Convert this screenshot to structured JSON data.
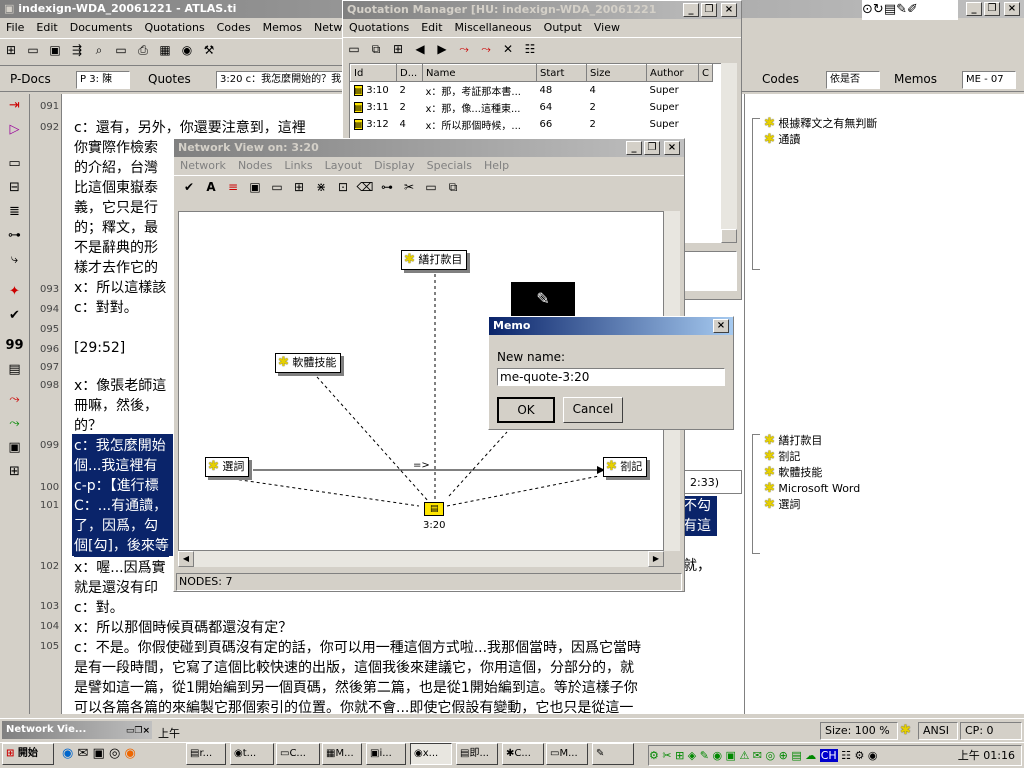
{
  "main_window": {
    "title": "indexign-WDA_20061221 - ATLAS.ti",
    "menu": [
      "File",
      "Edit",
      "Documents",
      "Quotations",
      "Codes",
      "Memos",
      "Networks"
    ],
    "pdocs_label": "P-Docs",
    "pdocs_value": "P 3: 陳",
    "quotes_label": "Quotes",
    "quotes_value": "3:20 c：我怎麼開始的？我",
    "codes_label": "Codes",
    "codes_value": "依是否",
    "memos_label": "Memos",
    "memos_value": "ME - 07"
  },
  "document": {
    "line_numbers": [
      "091",
      "092",
      "093",
      "094",
      "095",
      "096",
      "097",
      "098",
      "099",
      "100",
      "101",
      "102",
      "103",
      "104",
      "105"
    ],
    "lines": [
      "c：還有，另外，你還要注意到，這裡",
      "你實際作檢索",
      "的介紹，台灣",
      "比這個東嶽泰",
      "義，它只是行",
      "的；釋文，最",
      "不是辭典的形",
      "樣才去作它的",
      "x：所以這樣該",
      "c：對對。",
      "[29:52]",
      "x：像張老師這",
      "冊嘛，然後，",
      "的？",
      "c：我怎麼開始",
      "個...我這裡有",
      "c-p：【進行標",
      "C：...有通讀，",
      "了，因爲，勾",
      "個[勾]，後來等",
      "x：喔...因爲實",
      "就是還沒有印",
      "c：對。",
      "x：所以那個時候頁碼都還沒有定？",
      "c：不是。你假使碰到頁碼沒有定的話，你可以用一種這個方式啦...我那個當時，因爲它當時",
      "是有一段時間，它寫了這個比較快速的出版，這個我後來建議它，你用這個，分部分的，就",
      "是譬如這一篇，從1開始編到另一個頁碼，然後第二篇，也是從1開始編到這。等於這樣子你",
      "可以各篇各篇的來編製它那個索引的位置。你就不會...即使它假設有變動，它也只是從這一"
    ],
    "right_fragments": [
      "不勾",
      "有這",
      "就，"
    ]
  },
  "quotation_manager": {
    "title": "Quotation Manager [HU: indexign-WDA_20061221",
    "menu": [
      "Quotations",
      "Edit",
      "Miscellaneous",
      "Output",
      "View"
    ],
    "columns": [
      "Id",
      "D...",
      "Name",
      "Start",
      "Size",
      "Author",
      "C"
    ],
    "rows": [
      [
        "3:10",
        "2",
        "x：那，考証那本書...",
        "48",
        "4",
        "Super"
      ],
      [
        "3:11",
        "2",
        "x：那，像...這種東...",
        "64",
        "2",
        "Super"
      ],
      [
        "3:12",
        "4",
        "x：所以那個時候，...",
        "66",
        "2",
        "Super"
      ]
    ],
    "partial_text": "2:33)"
  },
  "network_view": {
    "title": "Network View on: 3:20",
    "menu": [
      "Network",
      "Nodes",
      "Links",
      "Layout",
      "Display",
      "Specials",
      "Help"
    ],
    "nodes": {
      "n1": "繕打款目",
      "n2": "軟體技能",
      "n3": "選詞",
      "n4": "劄記",
      "n5": "3:20"
    },
    "link_label": "=>",
    "status": "NODES: 7"
  },
  "memo_dialog": {
    "title": "Memo",
    "label": "New name:",
    "value": "me-quote-3:20",
    "ok": "OK",
    "cancel": "Cancel"
  },
  "margin_codes_top": [
    "根據釋文之有無判斷",
    "通讀"
  ],
  "margin_codes_bottom": [
    "繕打款目",
    "劄記",
    "軟體技能",
    "Microsoft Word",
    "選詞"
  ],
  "status_bar": {
    "minimized": "Network Vie...",
    "time_text": "上午",
    "size": "Size: 100 %",
    "encoding": "ANSI",
    "cp": "CP: 0"
  },
  "taskbar": {
    "start": "開始",
    "items": [
      "r...",
      "t...",
      "C...",
      "M...",
      "i...",
      "x...",
      "即...",
      "C...",
      "M..."
    ],
    "tray_lang": "CH",
    "clock": "上午 01:16"
  }
}
